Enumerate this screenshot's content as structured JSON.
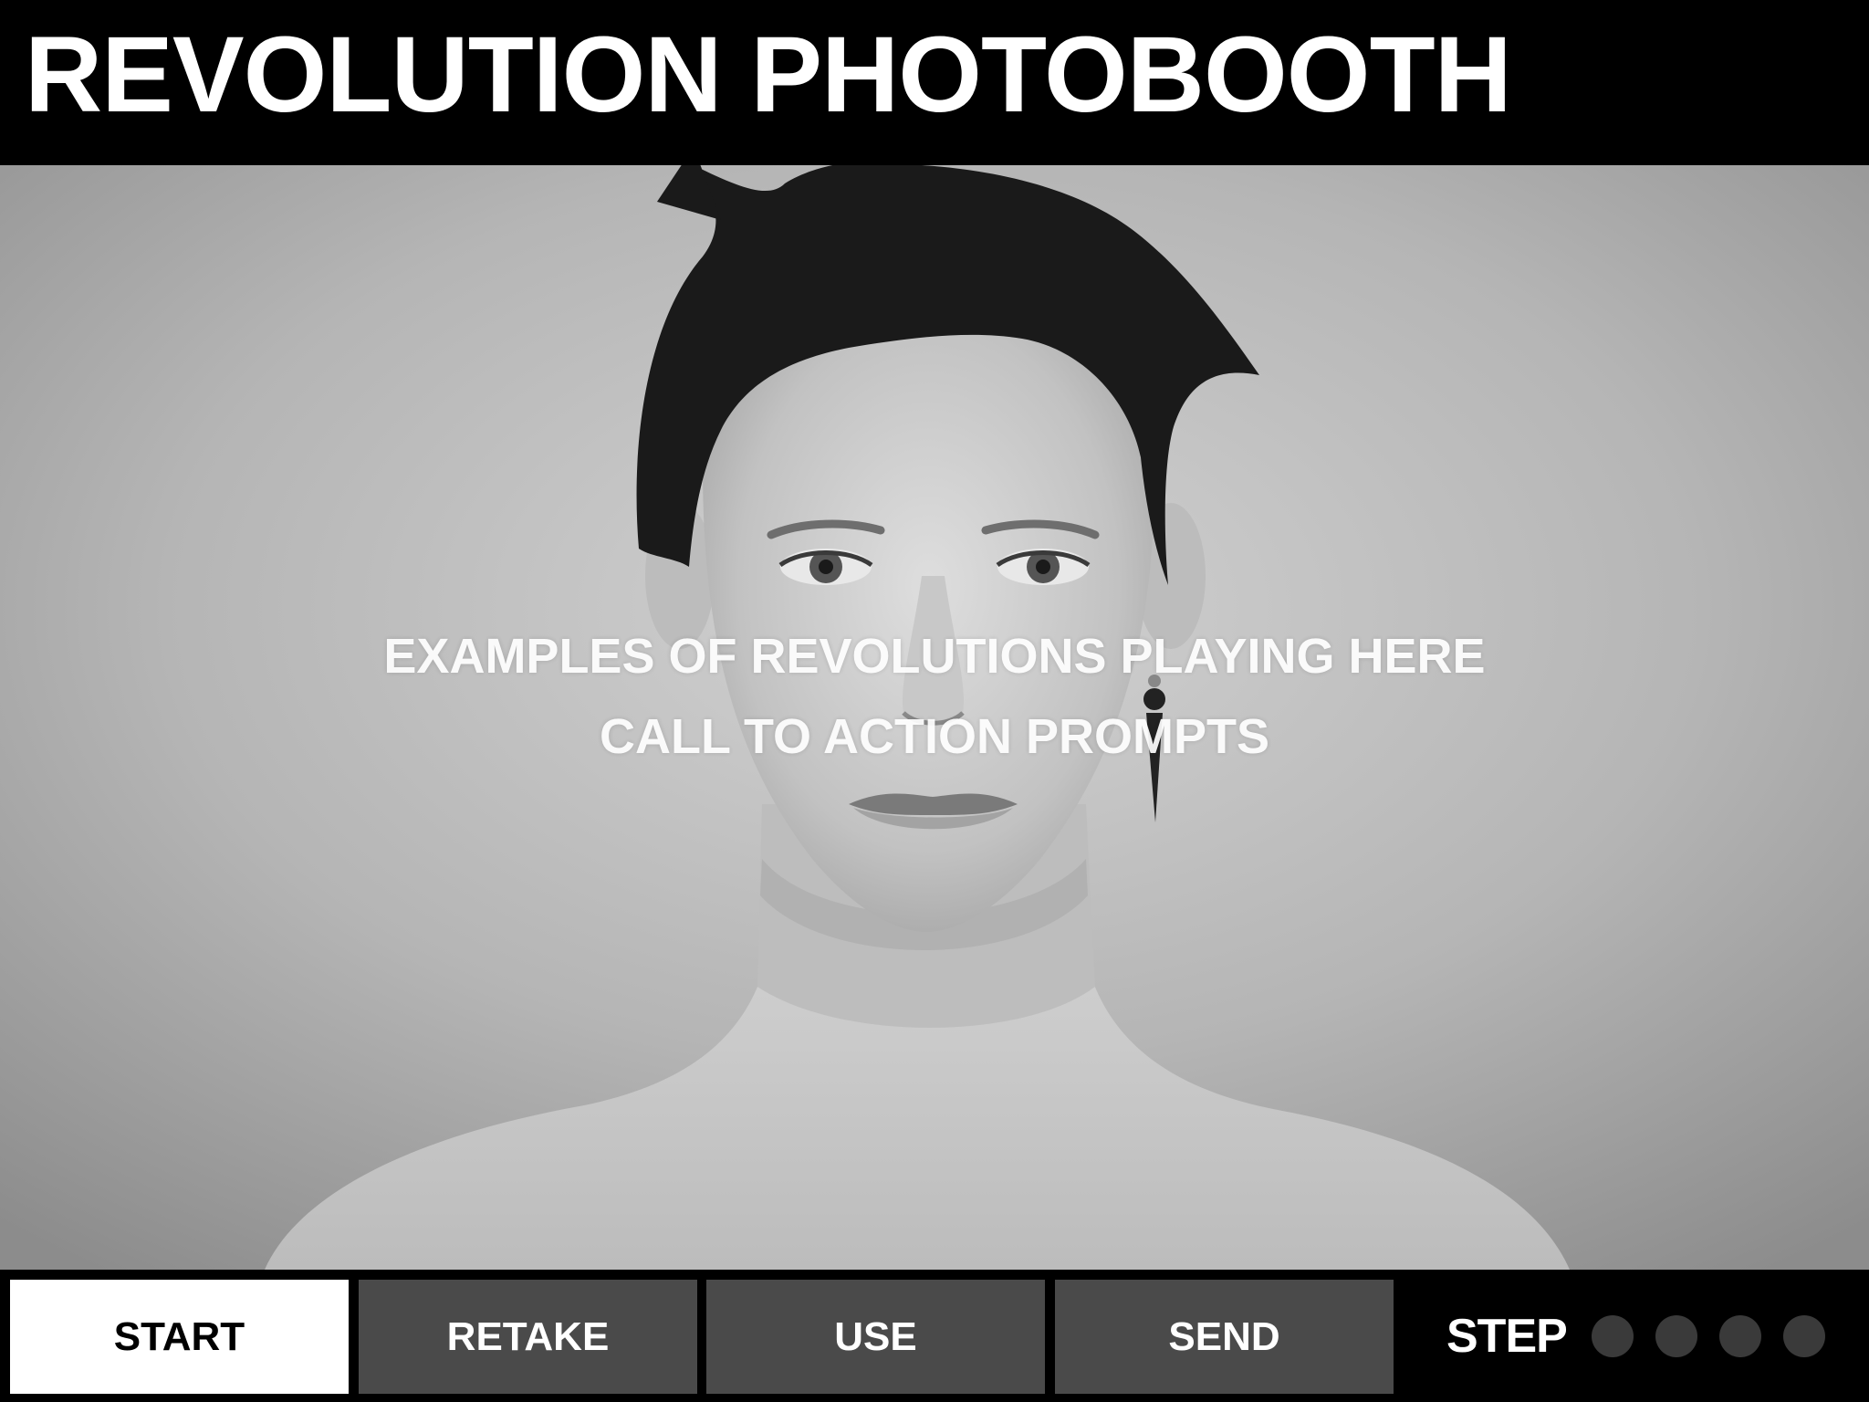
{
  "header": {
    "title": "REVOLUTION PHOTOBOOTH"
  },
  "preview": {
    "overlay_line_1": "EXAMPLES OF REVOLUTIONS PLAYING HERE",
    "overlay_line_2": "CALL TO ACTION PROMPTS"
  },
  "controls": {
    "buttons": [
      {
        "label": "START",
        "state": "active"
      },
      {
        "label": "RETAKE",
        "state": "inactive"
      },
      {
        "label": "USE",
        "state": "inactive"
      },
      {
        "label": "SEND",
        "state": "inactive"
      }
    ],
    "step_label": "STEP",
    "steps_total": 4,
    "steps_completed": 0
  },
  "colors": {
    "background": "#000000",
    "active_button": "#ffffff",
    "inactive_button": "#4a4a4a",
    "step_dot": "#3a3a3a",
    "text": "#ffffff"
  }
}
